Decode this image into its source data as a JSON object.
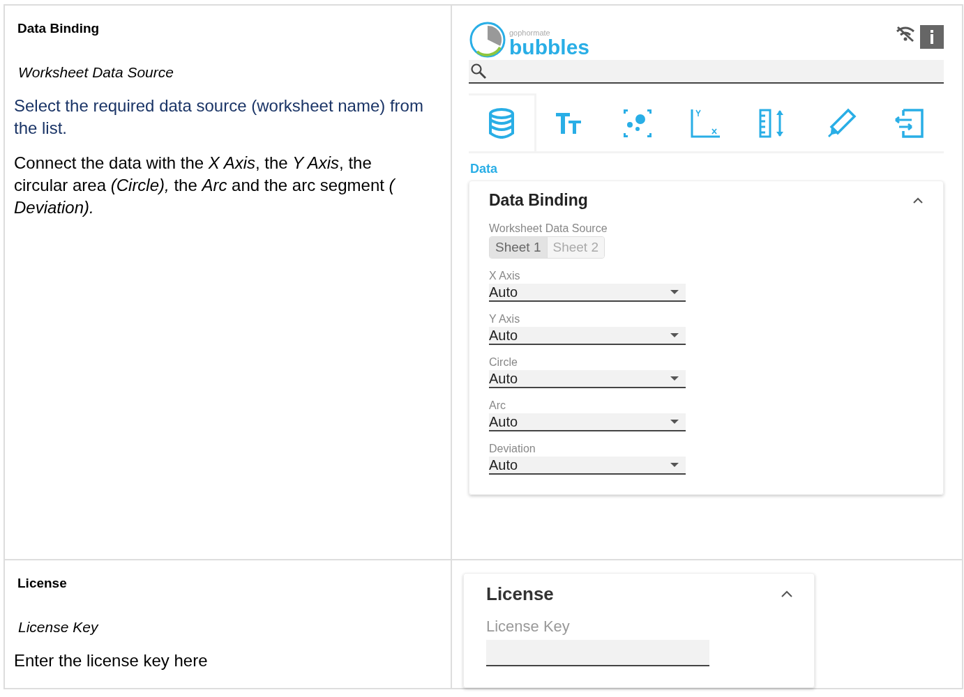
{
  "rows": [
    {
      "heading": "Data Binding",
      "field": "Worksheet Data Source",
      "description": "Select the required data source (worksheet name) from the list.",
      "note": "Connect the data with the *X Axis*, the *Y Axis*, the circular area *(Circle),* the *Arc* and the arc segment *( Deviation).*",
      "kind": "data"
    },
    {
      "heading": "License",
      "field": "License Key",
      "description": "Enter the license key here",
      "kind": "license"
    }
  ],
  "app": {
    "brand_small": "gophormate",
    "brand": "bubbles",
    "tabs": [
      {
        "kind": "database",
        "selected": true
      },
      {
        "kind": "text",
        "selected": false
      },
      {
        "kind": "scatter",
        "selected": false
      },
      {
        "kind": "axes",
        "selected": false
      },
      {
        "kind": "ruler",
        "selected": false
      },
      {
        "kind": "pen",
        "selected": false
      },
      {
        "kind": "export",
        "selected": false
      }
    ],
    "section": "Data",
    "panel": {
      "title": "Data Binding",
      "source_label": "Worksheet Data Source",
      "sheets": [
        {
          "label": "Sheet 1",
          "selected": true
        },
        {
          "label": "Sheet 2",
          "selected": false
        }
      ],
      "selects": [
        {
          "label": "X Axis",
          "value": "Auto"
        },
        {
          "label": "Y Axis",
          "value": "Auto"
        },
        {
          "label": "Circle",
          "value": "Auto"
        },
        {
          "label": "Arc",
          "value": "Auto"
        },
        {
          "label": "Deviation",
          "value": "Auto"
        }
      ]
    },
    "license": {
      "title": "License",
      "field_label": "License Key"
    }
  }
}
